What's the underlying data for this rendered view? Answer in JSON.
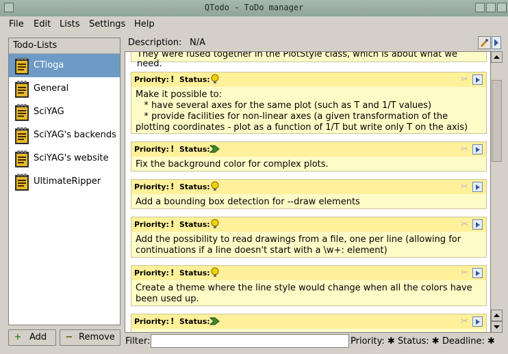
{
  "window": {
    "title": "QTodo - ToDo manager"
  },
  "menu": {
    "items": [
      "File",
      "Edit",
      "Lists",
      "Settings",
      "Help"
    ]
  },
  "lists": {
    "header": "Todo-Lists",
    "items": [
      {
        "label": "CTioga",
        "selected": true
      },
      {
        "label": "General"
      },
      {
        "label": "SciYAG"
      },
      {
        "label": "SciYAG's backends"
      },
      {
        "label": "SciYAG's website"
      },
      {
        "label": "UltimateRipper"
      }
    ],
    "add_label": "Add",
    "remove_label": "Remove"
  },
  "description": {
    "label": "Description:",
    "value": "N/A"
  },
  "tasks": {
    "partial_top": "They were fused together in the PlotStyle class, which is about what we need.",
    "priority_label": "Priority:",
    "status_label": "Status:",
    "items": [
      {
        "priority": "!",
        "status_icon": "bulb-icon",
        "body": "Make it possible to:\n   * have several axes for the same plot (such as T and 1/T values)\n   * provide facilities for non-linear axes (a given transformation of the plotting coordinates - plot as a function of 1/T but write only T on the axis)"
      },
      {
        "priority": "!",
        "status_icon": "arrow-icon",
        "body": "Fix the background color for complex plots."
      },
      {
        "priority": "!",
        "status_icon": "bulb-icon",
        "body": "Add a bounding box detection for --draw elements"
      },
      {
        "priority": "!",
        "status_icon": "bulb-icon",
        "body": "Add the possibility to read drawings from a file, one per line (allowing for continuations if a line doesn't start with a \\w+: element)"
      },
      {
        "priority": "!",
        "status_icon": "bulb-icon",
        "body": "Create a theme where the line style would change when all the colors have been used up."
      },
      {
        "priority": "!",
        "status_icon": "arrow-icon",
        "body": ""
      }
    ]
  },
  "filter": {
    "label": "Filter:",
    "value": "",
    "right_text": "Priority: ✱ Status: ✱ Deadline: ✱"
  }
}
